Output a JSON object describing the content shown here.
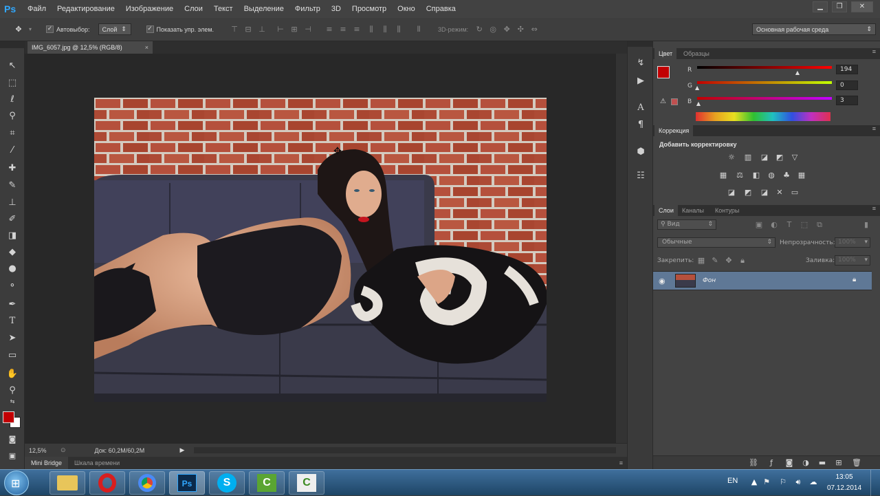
{
  "app": {
    "logo": "Ps"
  },
  "menu": [
    "Файл",
    "Редактирование",
    "Изображение",
    "Слои",
    "Текст",
    "Выделение",
    "Фильтр",
    "3D",
    "Просмотр",
    "Окно",
    "Справка"
  ],
  "options": {
    "autoselect_label": "Автовыбор:",
    "autoselect_value": "Слой",
    "show_controls_label": "Показать упр. элем.",
    "mode3d_label": "3D-режим:",
    "workspace": "Основная рабочая среда"
  },
  "document": {
    "tab_title": "IMG_6057.jpg @ 12,5% (RGB/8)"
  },
  "status": {
    "zoom": "12,5%",
    "doc_info": "Док: 60,2M/60,2M"
  },
  "bottom_tabs": [
    "Mini Bridge",
    "Шкала времени"
  ],
  "color_panel": {
    "tabs": [
      "Цвет",
      "Образцы"
    ],
    "channels": [
      {
        "label": "R",
        "value": "194",
        "fraction": 0.76
      },
      {
        "label": "G",
        "value": "0",
        "fraction": 0.0
      },
      {
        "label": "B",
        "value": "3",
        "fraction": 0.01
      }
    ],
    "foreground": "#c20003"
  },
  "adjustments_panel": {
    "title": "Коррекция",
    "subtitle": "Добавить корректировку"
  },
  "layers_panel": {
    "tabs": [
      "Слои",
      "Каналы",
      "Контуры"
    ],
    "filter": "Вид",
    "blend_mode": "Обычные",
    "opacity_label": "Непрозрачность:",
    "opacity_value": "100%",
    "lock_label": "Закрепить:",
    "fill_label": "Заливка:",
    "fill_value": "100%",
    "layers": [
      {
        "name": "Фон"
      }
    ]
  },
  "taskbar": {
    "lang": "EN",
    "time": "13:05",
    "date": "07.12.2014"
  },
  "colors": {
    "accent": "#31a8ff",
    "selection": "#5f7896",
    "fg_swatch": "#c20003",
    "bg_swatch": "#ffffff"
  }
}
